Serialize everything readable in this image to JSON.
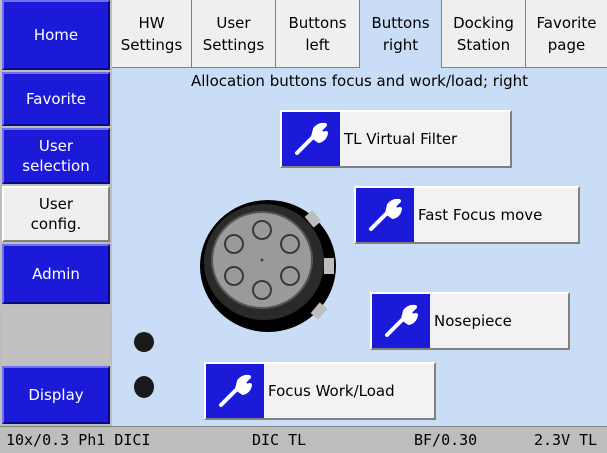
{
  "sidebar": {
    "items": [
      {
        "label": "Home"
      },
      {
        "label": "Favorite"
      },
      {
        "label": "User\nselection"
      },
      {
        "label": "User\nconfig."
      },
      {
        "label": "Admin"
      },
      {
        "label": "Display"
      }
    ]
  },
  "tabs": [
    {
      "label": "HW\nSettings"
    },
    {
      "label": "User\nSettings"
    },
    {
      "label": "Buttons\nleft"
    },
    {
      "label": "Buttons\nright"
    },
    {
      "label": "Docking\nStation"
    },
    {
      "label": "Favorite\npage"
    }
  ],
  "main": {
    "title": "Allocation buttons focus and work/load; right",
    "buttons": [
      {
        "label": "TL Virtual Filter"
      },
      {
        "label": "Fast Focus move"
      },
      {
        "label": "Nosepiece"
      },
      {
        "label": "Focus Work/Load"
      }
    ]
  },
  "statusbar": {
    "objective": "10x/0.3 Ph1 DICI",
    "contrast": "DIC TL",
    "filter": "BF/0.30",
    "voltage": "2.3V TL"
  },
  "colors": {
    "accent_blue": "#1a1ad8",
    "panel_bg": "#c9ddf7",
    "status_bg": "#bdbdbd"
  },
  "icons": [
    "wrench-icon",
    "focus-knob-icon",
    "indicator-dot-icon"
  ]
}
